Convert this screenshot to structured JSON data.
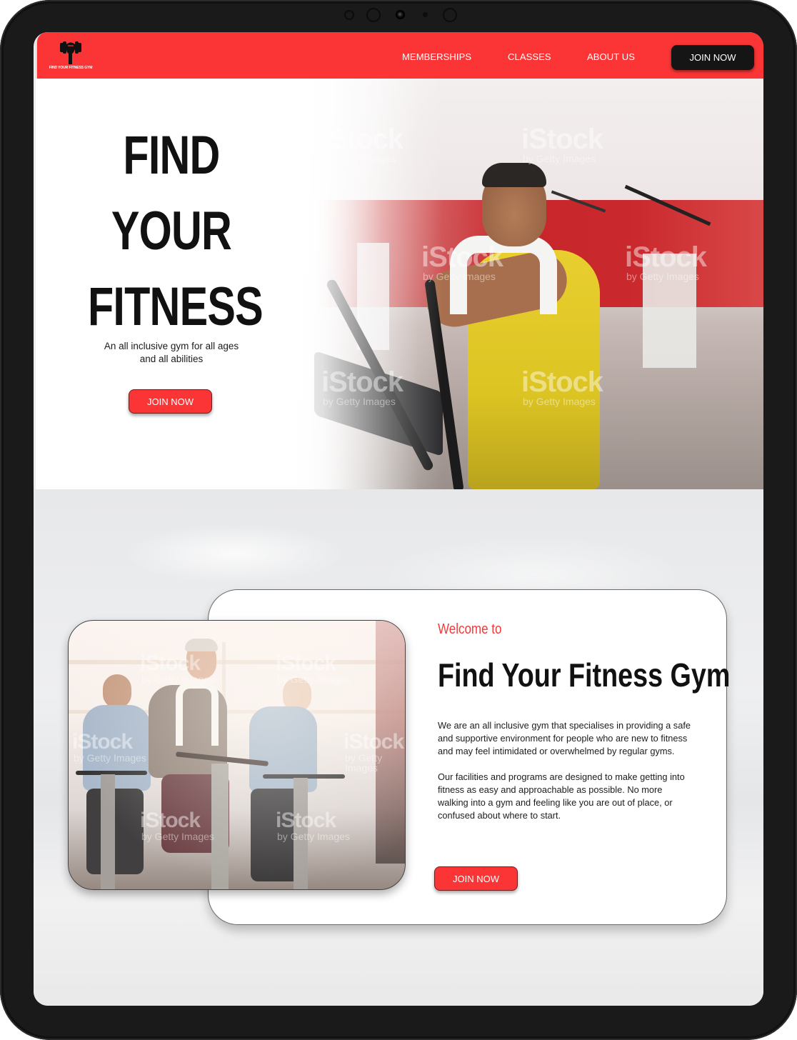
{
  "device": {
    "type": "tablet"
  },
  "navbar": {
    "logo_text": "FIND YOUR FITNESS GYM",
    "links": [
      {
        "label": "MEMBERSHIPS"
      },
      {
        "label": "CLASSES"
      },
      {
        "label": "ABOUT US"
      }
    ],
    "cta_label": "JOIN NOW"
  },
  "hero": {
    "title_lines": [
      "FIND",
      "YOUR",
      "FITNESS"
    ],
    "subtitle": "An all inclusive gym for all ages and all abilities",
    "cta_label": "JOIN NOW",
    "image_alt": "Smiling man in yellow tank top with towel on elliptical trainer",
    "watermark": "iStock",
    "watermark_sub": "by Getty Images"
  },
  "about": {
    "eyebrow": "Welcome to",
    "title": "Find Your Fitness Gym",
    "paragraphs": [
      "We are an all inclusive gym that specialises in providing a safe and supportive environment for people who are new to fitness and may feel intimidated or overwhelmed by regular gyms.",
      "Our facilities and programs are designed to make getting into fitness as easy and approachable as possible. No more walking into a gym and feeling like you are out of place, or confused about where to start."
    ],
    "cta_label": "JOIN NOW",
    "image_alt": "Group of mature adults smiling on spin bikes in an exercise class"
  },
  "colors": {
    "brand_red": "#fb3535",
    "dark_button": "#151515",
    "eyebrow_red": "#f23a3a",
    "text": "#111111"
  }
}
